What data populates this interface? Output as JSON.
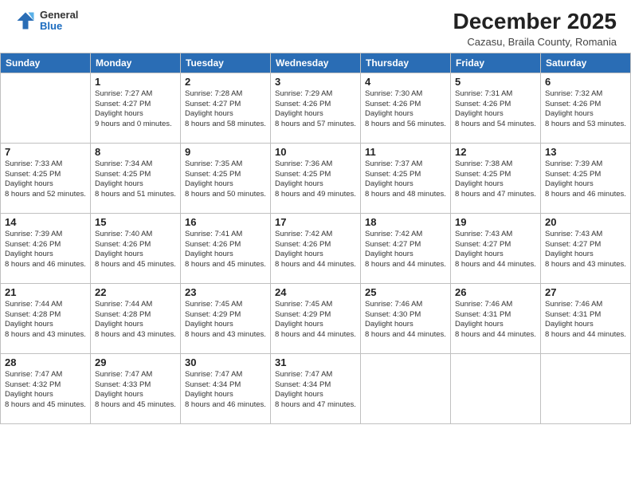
{
  "header": {
    "logo_general": "General",
    "logo_blue": "Blue",
    "title": "December 2025",
    "subtitle": "Cazasu, Braila County, Romania"
  },
  "weekdays": [
    "Sunday",
    "Monday",
    "Tuesday",
    "Wednesday",
    "Thursday",
    "Friday",
    "Saturday"
  ],
  "weeks": [
    [
      {
        "day": null,
        "info": null
      },
      {
        "day": "1",
        "sunrise": "7:27 AM",
        "sunset": "4:27 PM",
        "daylight": "9 hours and 0 minutes."
      },
      {
        "day": "2",
        "sunrise": "7:28 AM",
        "sunset": "4:27 PM",
        "daylight": "8 hours and 58 minutes."
      },
      {
        "day": "3",
        "sunrise": "7:29 AM",
        "sunset": "4:26 PM",
        "daylight": "8 hours and 57 minutes."
      },
      {
        "day": "4",
        "sunrise": "7:30 AM",
        "sunset": "4:26 PM",
        "daylight": "8 hours and 56 minutes."
      },
      {
        "day": "5",
        "sunrise": "7:31 AM",
        "sunset": "4:26 PM",
        "daylight": "8 hours and 54 minutes."
      },
      {
        "day": "6",
        "sunrise": "7:32 AM",
        "sunset": "4:26 PM",
        "daylight": "8 hours and 53 minutes."
      }
    ],
    [
      {
        "day": "7",
        "sunrise": "7:33 AM",
        "sunset": "4:25 PM",
        "daylight": "8 hours and 52 minutes."
      },
      {
        "day": "8",
        "sunrise": "7:34 AM",
        "sunset": "4:25 PM",
        "daylight": "8 hours and 51 minutes."
      },
      {
        "day": "9",
        "sunrise": "7:35 AM",
        "sunset": "4:25 PM",
        "daylight": "8 hours and 50 minutes."
      },
      {
        "day": "10",
        "sunrise": "7:36 AM",
        "sunset": "4:25 PM",
        "daylight": "8 hours and 49 minutes."
      },
      {
        "day": "11",
        "sunrise": "7:37 AM",
        "sunset": "4:25 PM",
        "daylight": "8 hours and 48 minutes."
      },
      {
        "day": "12",
        "sunrise": "7:38 AM",
        "sunset": "4:25 PM",
        "daylight": "8 hours and 47 minutes."
      },
      {
        "day": "13",
        "sunrise": "7:39 AM",
        "sunset": "4:25 PM",
        "daylight": "8 hours and 46 minutes."
      }
    ],
    [
      {
        "day": "14",
        "sunrise": "7:39 AM",
        "sunset": "4:26 PM",
        "daylight": "8 hours and 46 minutes."
      },
      {
        "day": "15",
        "sunrise": "7:40 AM",
        "sunset": "4:26 PM",
        "daylight": "8 hours and 45 minutes."
      },
      {
        "day": "16",
        "sunrise": "7:41 AM",
        "sunset": "4:26 PM",
        "daylight": "8 hours and 45 minutes."
      },
      {
        "day": "17",
        "sunrise": "7:42 AM",
        "sunset": "4:26 PM",
        "daylight": "8 hours and 44 minutes."
      },
      {
        "day": "18",
        "sunrise": "7:42 AM",
        "sunset": "4:27 PM",
        "daylight": "8 hours and 44 minutes."
      },
      {
        "day": "19",
        "sunrise": "7:43 AM",
        "sunset": "4:27 PM",
        "daylight": "8 hours and 44 minutes."
      },
      {
        "day": "20",
        "sunrise": "7:43 AM",
        "sunset": "4:27 PM",
        "daylight": "8 hours and 43 minutes."
      }
    ],
    [
      {
        "day": "21",
        "sunrise": "7:44 AM",
        "sunset": "4:28 PM",
        "daylight": "8 hours and 43 minutes."
      },
      {
        "day": "22",
        "sunrise": "7:44 AM",
        "sunset": "4:28 PM",
        "daylight": "8 hours and 43 minutes."
      },
      {
        "day": "23",
        "sunrise": "7:45 AM",
        "sunset": "4:29 PM",
        "daylight": "8 hours and 43 minutes."
      },
      {
        "day": "24",
        "sunrise": "7:45 AM",
        "sunset": "4:29 PM",
        "daylight": "8 hours and 44 minutes."
      },
      {
        "day": "25",
        "sunrise": "7:46 AM",
        "sunset": "4:30 PM",
        "daylight": "8 hours and 44 minutes."
      },
      {
        "day": "26",
        "sunrise": "7:46 AM",
        "sunset": "4:31 PM",
        "daylight": "8 hours and 44 minutes."
      },
      {
        "day": "27",
        "sunrise": "7:46 AM",
        "sunset": "4:31 PM",
        "daylight": "8 hours and 44 minutes."
      }
    ],
    [
      {
        "day": "28",
        "sunrise": "7:47 AM",
        "sunset": "4:32 PM",
        "daylight": "8 hours and 45 minutes."
      },
      {
        "day": "29",
        "sunrise": "7:47 AM",
        "sunset": "4:33 PM",
        "daylight": "8 hours and 45 minutes."
      },
      {
        "day": "30",
        "sunrise": "7:47 AM",
        "sunset": "4:34 PM",
        "daylight": "8 hours and 46 minutes."
      },
      {
        "day": "31",
        "sunrise": "7:47 AM",
        "sunset": "4:34 PM",
        "daylight": "8 hours and 47 minutes."
      },
      {
        "day": null,
        "info": null
      },
      {
        "day": null,
        "info": null
      },
      {
        "day": null,
        "info": null
      }
    ]
  ],
  "labels": {
    "sunrise_prefix": "Sunrise: ",
    "sunset_prefix": "Sunset: ",
    "daylight_label": "Daylight hours"
  }
}
